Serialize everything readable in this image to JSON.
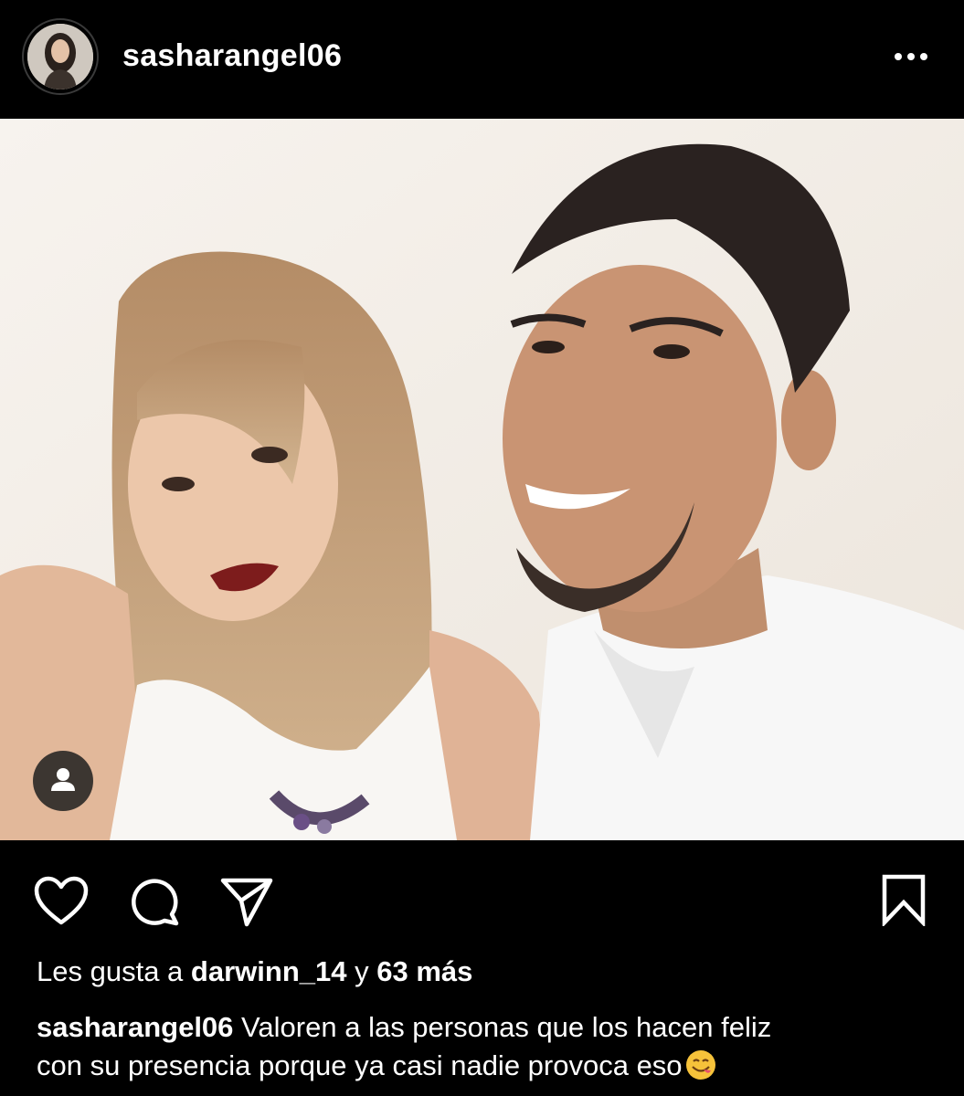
{
  "post": {
    "username": "sasharangel06",
    "likes": {
      "prefix": "Les gusta a",
      "liker": "darwinn_14",
      "conjunction": "y",
      "others": "63 más"
    },
    "caption": {
      "username": "sasharangel06",
      "text_line1": "Valoren a las personas que los hacen feliz",
      "text_line2": "con su presencia porque ya casi nadie provoca eso",
      "emoji": "face-savoring-food-emoji"
    }
  },
  "icons": {
    "more": "more-horizontal-icon",
    "tag": "person-tag-icon",
    "like": "heart-icon",
    "comment": "comment-bubble-icon",
    "share": "paper-plane-icon",
    "save": "bookmark-icon"
  },
  "colors": {
    "background": "#000000",
    "text": "#ffffff",
    "photo_wall": "#f1ece5"
  }
}
